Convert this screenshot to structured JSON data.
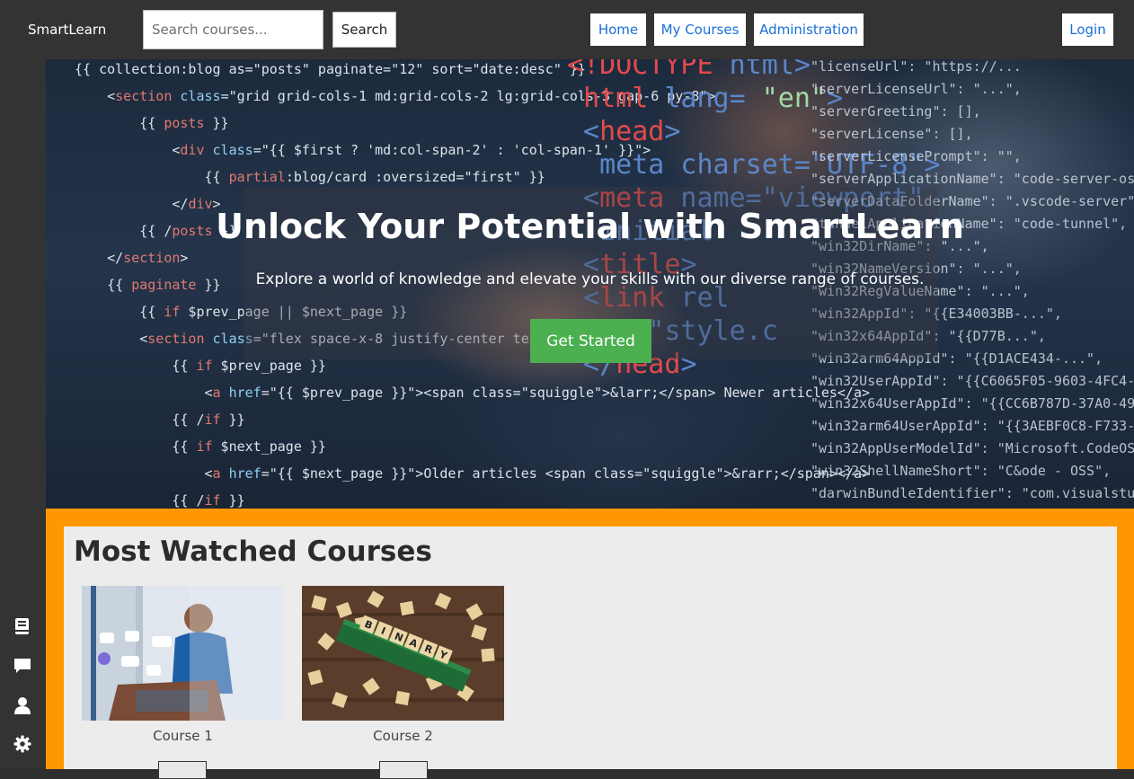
{
  "header": {
    "brand": "SmartLearn",
    "search_placeholder": "Search courses...",
    "search_button": "Search",
    "nav": {
      "home": "Home",
      "my_courses": "My Courses",
      "administration": "Administration",
      "login": "Login"
    }
  },
  "sidebar": {
    "icons": [
      "book-icon",
      "chat-icon",
      "user-icon",
      "gear-icon"
    ]
  },
  "hero": {
    "title": "Unlock Your Potential with SmartLearn",
    "subtitle": "Explore a world of knowledge and elevate your skills with our diverse range of courses.",
    "cta": "Get Started"
  },
  "most_watched": {
    "title": "Most Watched Courses",
    "courses": [
      {
        "label": "Course 1"
      },
      {
        "label": "Course 2"
      }
    ]
  },
  "colors": {
    "topbar": "#333333",
    "accent_orange": "#ff9800",
    "cta_green": "#4caf50",
    "link_blue": "#1a6fd6"
  }
}
